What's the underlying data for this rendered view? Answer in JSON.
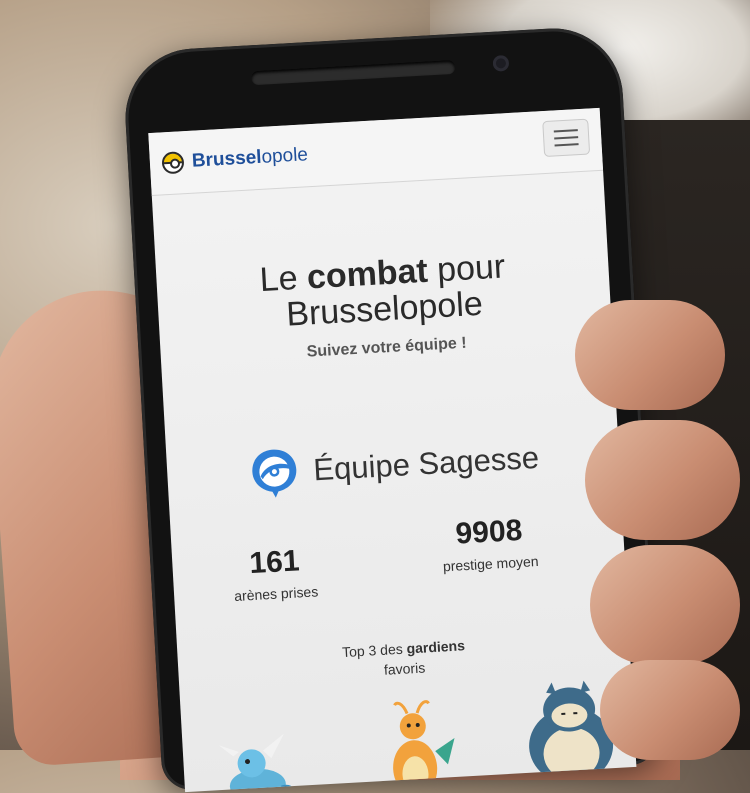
{
  "navbar": {
    "brand_bold": "Brussel",
    "brand_rest": "opole",
    "menu_icon": "hamburger-icon",
    "brand_icon": "pokeball-icon"
  },
  "hero": {
    "title_part1": "Le ",
    "title_bold": "combat",
    "title_part2": " pour",
    "title_line2": "Brusselopole",
    "subtitle": "Suivez votre équipe !"
  },
  "team": {
    "name": "Équipe Sagesse",
    "icon": "team-mystic-icon",
    "color": "#2f7fd6"
  },
  "stats": [
    {
      "value": "161",
      "label": "arènes prises"
    },
    {
      "value": "9908",
      "label": "prestige moyen"
    }
  ],
  "top3": {
    "prefix": "Top 3 des ",
    "bold": "gardiens",
    "suffix": "favoris"
  },
  "guardians": [
    {
      "icon": "vaporeon-icon"
    },
    {
      "icon": "dragonite-icon"
    },
    {
      "icon": "snorlax-icon"
    }
  ]
}
